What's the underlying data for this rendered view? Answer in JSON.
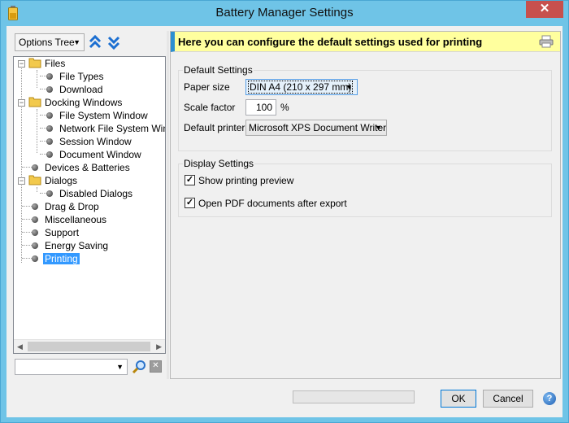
{
  "window": {
    "title": "Battery Manager Settings",
    "close_label": "✕"
  },
  "left": {
    "options_select": "Options Tree",
    "tree": [
      {
        "label": "Files"
      },
      {
        "label": "File Types"
      },
      {
        "label": "Download"
      },
      {
        "label": "Docking Windows"
      },
      {
        "label": "File System Window"
      },
      {
        "label": "Network File System Window"
      },
      {
        "label": "Session Window"
      },
      {
        "label": "Document Window"
      },
      {
        "label": "Devices & Batteries"
      },
      {
        "label": "Dialogs"
      },
      {
        "label": "Disabled Dialogs"
      },
      {
        "label": "Drag & Drop"
      },
      {
        "label": "Miscellaneous"
      },
      {
        "label": "Support"
      },
      {
        "label": "Energy Saving"
      },
      {
        "label": "Printing"
      }
    ],
    "selected_item": "Printing",
    "search_value": ""
  },
  "banner": {
    "text": "Here you can configure the default settings used for printing"
  },
  "default_settings": {
    "title": "Default Settings",
    "paper_size_label": "Paper size",
    "paper_size_value": "DIN A4 (210 x 297 mm)",
    "scale_factor_label": "Scale factor",
    "scale_factor_value": "100",
    "scale_factor_unit": "%",
    "default_printer_label": "Default printer",
    "default_printer_value": "Microsoft XPS Document Writer"
  },
  "display_settings": {
    "title": "Display Settings",
    "show_preview_label": "Show printing preview",
    "show_preview_checked": true,
    "open_pdf_label": "Open PDF documents after export",
    "open_pdf_checked": true
  },
  "footer": {
    "progress": 0,
    "ok_label": "OK",
    "cancel_label": "Cancel",
    "help_label": "?"
  },
  "colors": {
    "accent": "#2c8fd1",
    "banner_bg": "#ffff9e",
    "selection": "#3399ff",
    "titlebar": "#6fc4e7",
    "close": "#c7504d"
  }
}
